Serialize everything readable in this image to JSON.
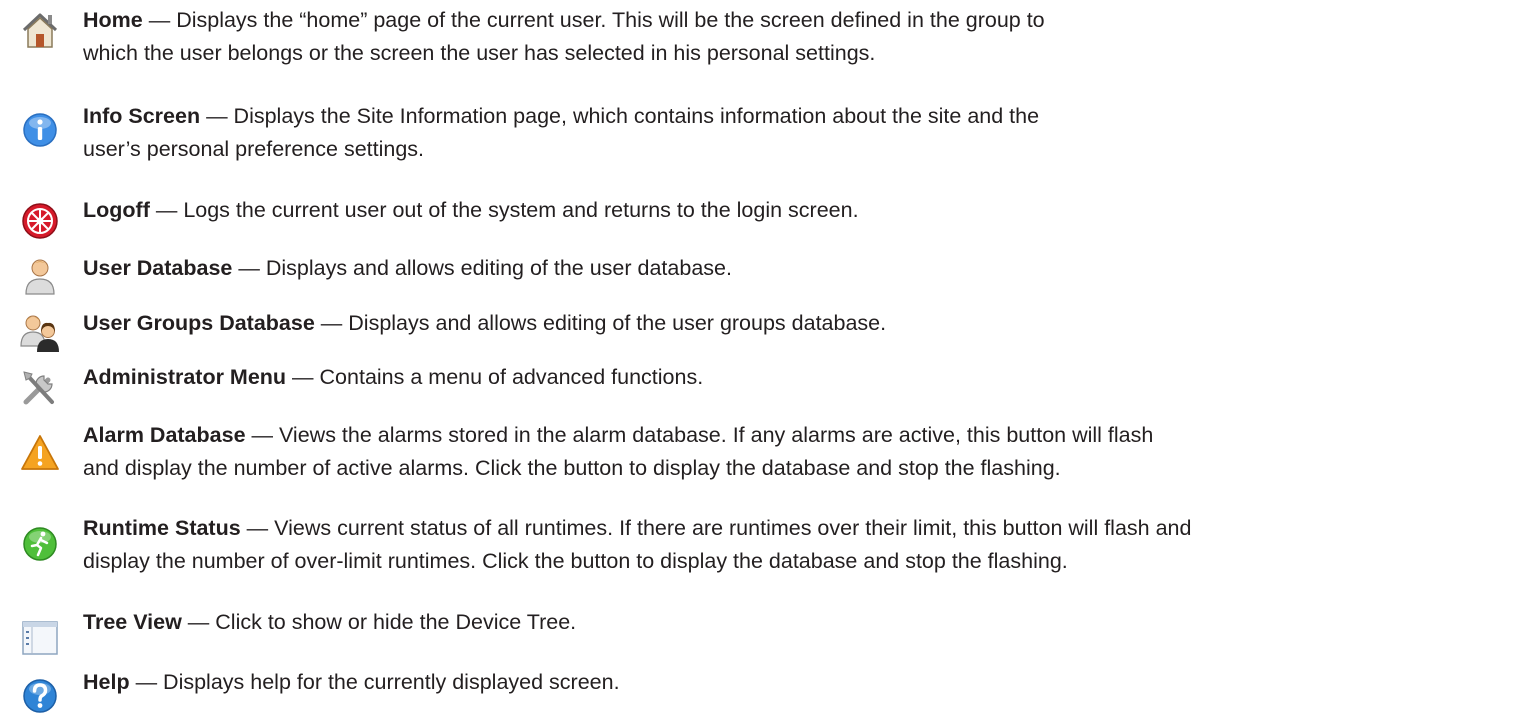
{
  "items": [
    {
      "icon": "home-icon",
      "title": "Home",
      "sep": " — ",
      "lines": [
        "Displays the “home” page of the current user.  This will be the screen defined in the group to",
        "which the user belongs or the screen the user has selected in his personal settings."
      ]
    },
    {
      "icon": "info-icon",
      "title": "Info Screen",
      "sep": " — ",
      "lines": [
        "Displays the Site Information page, which contains information about the site and the",
        "user’s personal preference settings."
      ]
    },
    {
      "icon": "logoff-icon",
      "title": "Logoff",
      "sep": " — ",
      "lines": [
        "Logs the current user out of the system and returns to the login screen."
      ]
    },
    {
      "icon": "user-icon",
      "title": "User Database",
      "sep": " — ",
      "lines": [
        "Displays and allows editing of the user database."
      ]
    },
    {
      "icon": "user-groups-icon",
      "title": "User Groups Database",
      "sep": " — ",
      "lines": [
        "Displays and allows editing of the user groups database."
      ]
    },
    {
      "icon": "tools-icon",
      "title": "Administrator Menu",
      "sep": " — ",
      "lines": [
        "Contains a menu of advanced functions."
      ]
    },
    {
      "icon": "alarm-warning-icon",
      "title": "Alarm Database",
      "sep": " — ",
      "lines": [
        "Views the alarms stored in the alarm database.  If any alarms are active, this button will flash",
        "and display the number of active alarms.  Click the button to display the database and stop the flashing."
      ]
    },
    {
      "icon": "runtime-status-icon",
      "title": "Runtime Status",
      "sep": " — ",
      "lines": [
        "Views current status of all runtimes.  If there are runtimes over their limit, this button will flash and",
        "display the number of over-limit runtimes.  Click the button to display the database and stop the flashing."
      ]
    },
    {
      "icon": "tree-view-icon",
      "title": "Tree View",
      "sep": " — ",
      "lines": [
        "Click to show or hide the Device Tree."
      ]
    },
    {
      "icon": "help-icon",
      "title": "Help",
      "sep": " — ",
      "lines": [
        "Displays help for the currently displayed screen."
      ]
    }
  ]
}
